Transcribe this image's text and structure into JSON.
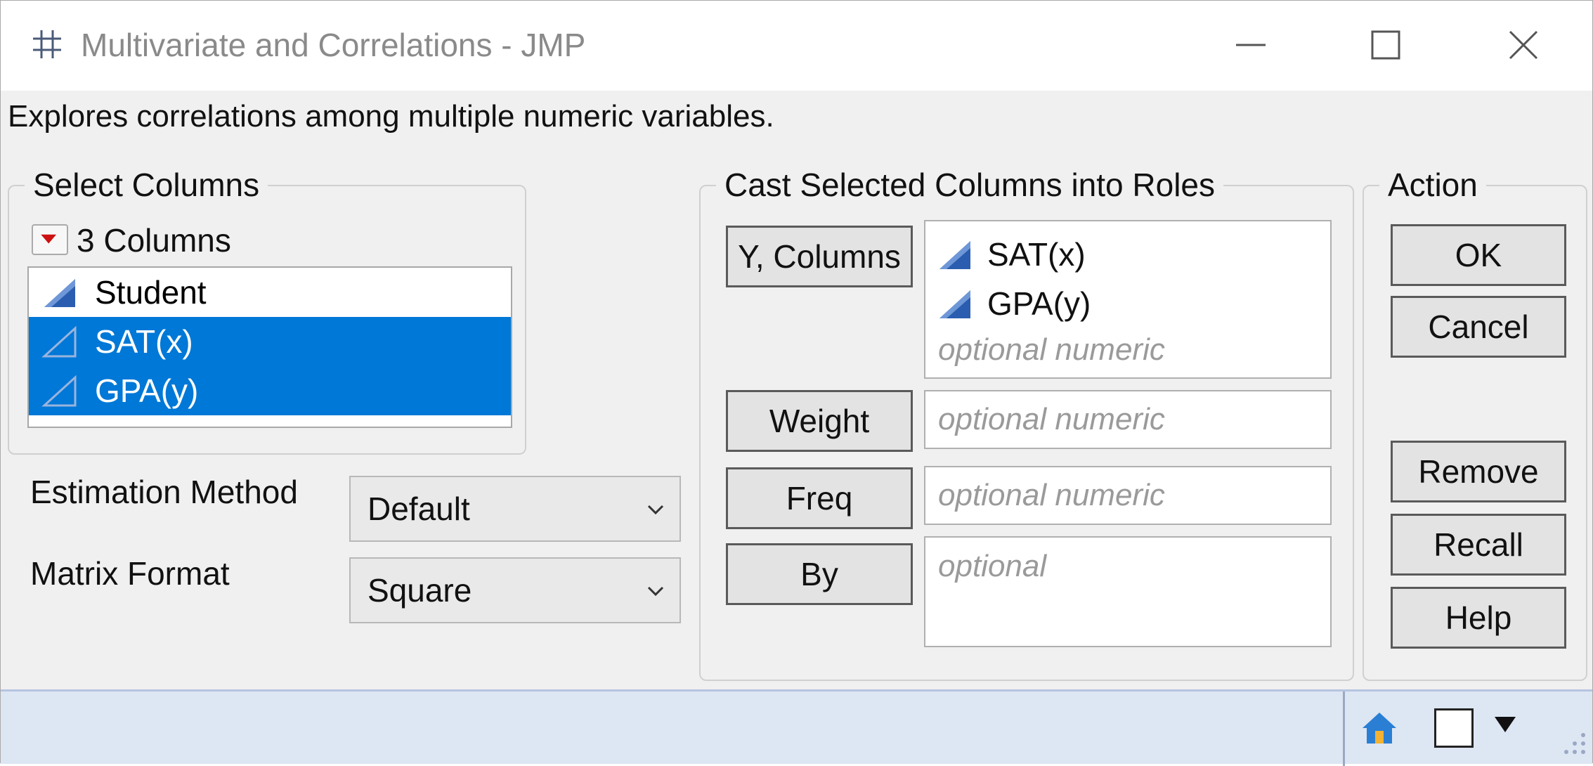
{
  "window": {
    "title": "Multivariate and Correlations - JMP",
    "description": "Explores correlations among multiple numeric variables."
  },
  "select_columns": {
    "legend": "Select Columns",
    "count_label": "3 Columns",
    "columns": [
      {
        "name": "Student",
        "selected": false
      },
      {
        "name": "SAT(x)",
        "selected": true
      },
      {
        "name": "GPA(y)",
        "selected": true
      }
    ]
  },
  "options": {
    "estimation_label": "Estimation Method",
    "estimation_value": "Default",
    "matrix_label": "Matrix Format",
    "matrix_value": "Square"
  },
  "roles": {
    "legend": "Cast Selected Columns into Roles",
    "y_columns": {
      "button": "Y, Columns",
      "items": [
        "SAT(x)",
        "GPA(y)"
      ],
      "placeholder": "optional numeric"
    },
    "weight": {
      "button": "Weight",
      "placeholder": "optional numeric"
    },
    "freq": {
      "button": "Freq",
      "placeholder": "optional numeric"
    },
    "by": {
      "button": "By",
      "placeholder": "optional"
    }
  },
  "action": {
    "legend": "Action",
    "ok": "OK",
    "cancel": "Cancel",
    "remove": "Remove",
    "recall": "Recall",
    "help": "Help"
  },
  "icons": {
    "title": "jmp-grid-icon",
    "continuous_column": "continuous-column-icon",
    "status_home": "home-icon"
  },
  "colors": {
    "selection": "#0078d7",
    "continuous_icon": "#2a5db0",
    "statusbar": "#dde6f3"
  }
}
